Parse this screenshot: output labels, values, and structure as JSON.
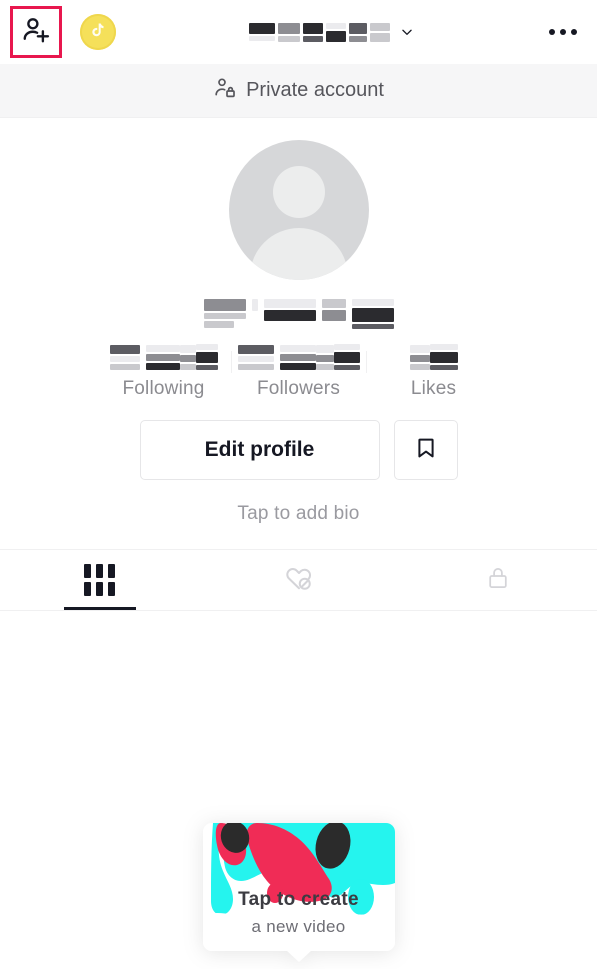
{
  "header": {
    "add_user_icon": "add-user-icon",
    "coin_icon": "tiktok-coin-icon",
    "username_redacted": true,
    "chevron_icon": "chevron-down-icon",
    "more_icon": "more-options-icon"
  },
  "private_bar": {
    "icon": "person-lock-icon",
    "label": "Private account"
  },
  "profile": {
    "avatar_icon": "default-avatar-icon",
    "handle_redacted": true,
    "stats": [
      {
        "label": "Following",
        "value_redacted": true
      },
      {
        "label": "Followers",
        "value_redacted": true
      },
      {
        "label": "Likes",
        "value_redacted": true
      }
    ],
    "edit_profile_label": "Edit profile",
    "bookmark_icon": "bookmark-icon",
    "bio_placeholder": "Tap to add bio"
  },
  "tabs": [
    {
      "name": "videos",
      "icon": "grid-icon",
      "active": true
    },
    {
      "name": "liked",
      "icon": "heart-slash-icon",
      "active": false
    },
    {
      "name": "private",
      "icon": "lock-icon",
      "active": false
    }
  ],
  "tooltip": {
    "title": "Tap to create",
    "subtitle": "a new video"
  },
  "colors": {
    "highlight": "#e8174e",
    "coin": "#f5e05a",
    "splash_teal": "#25F4EE",
    "splash_red": "#F02C56",
    "splash_black": "#2B2B2B",
    "text_primary": "#161823",
    "text_muted": "#8b8b90",
    "bar_bg": "#f6f6f7"
  }
}
